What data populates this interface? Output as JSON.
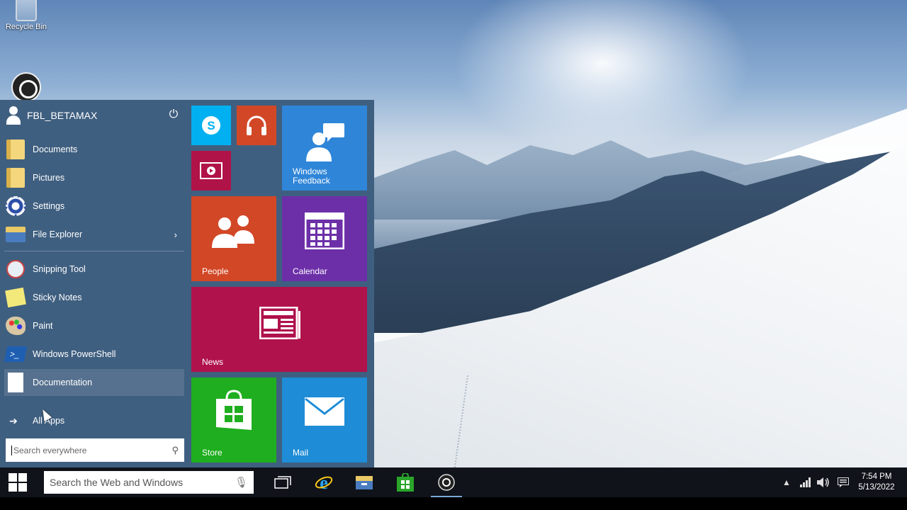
{
  "desktop": {
    "icons": [
      {
        "label": "Recycle Bin",
        "icon": "recycle-bin-icon"
      },
      {
        "label": "",
        "icon": "obs-studio-icon"
      }
    ]
  },
  "start_menu": {
    "user": "FBL_BETAMAX",
    "power_icon": "power-icon",
    "items": [
      {
        "label": "Documents",
        "icon": "documents-folder-icon"
      },
      {
        "label": "Pictures",
        "icon": "pictures-folder-icon"
      },
      {
        "label": "Settings",
        "icon": "settings-gear-icon"
      },
      {
        "label": "File Explorer",
        "icon": "file-explorer-icon",
        "has_submenu": true
      },
      {
        "label": "Snipping Tool",
        "icon": "snipping-tool-icon"
      },
      {
        "label": "Sticky Notes",
        "icon": "sticky-notes-icon"
      },
      {
        "label": "Paint",
        "icon": "paint-icon"
      },
      {
        "label": "Windows PowerShell",
        "icon": "powershell-icon"
      },
      {
        "label": "Documentation",
        "icon": "document-icon",
        "selected": true
      }
    ],
    "all_apps": "All Apps",
    "search_placeholder": "Search everywhere",
    "tiles": {
      "skype": {
        "label": "",
        "color": "#00b0f0"
      },
      "music": {
        "label": "",
        "color": "#d24726"
      },
      "video": {
        "label": "",
        "color": "#b01348"
      },
      "feedback": {
        "label": "Windows Feedback",
        "color": "#2f86d8"
      },
      "people": {
        "label": "People",
        "color": "#d24726"
      },
      "calendar": {
        "label": "Calendar",
        "color": "#6c2fa8"
      },
      "news": {
        "label": "News",
        "color": "#b0124b"
      },
      "store": {
        "label": "Store",
        "color": "#1fae1f"
      },
      "mail": {
        "label": "Mail",
        "color": "#1e8cd6"
      }
    }
  },
  "taskbar": {
    "search_placeholder": "Search the Web and Windows",
    "apps": [
      "task-view-icon",
      "internet-explorer-icon",
      "file-explorer-icon",
      "store-icon",
      "obs-studio-icon"
    ],
    "time": "7:54 PM",
    "date": "5/13/2022"
  },
  "colors": {
    "start_bg": "#3f5f80",
    "taskbar_bg": "#10131a"
  }
}
